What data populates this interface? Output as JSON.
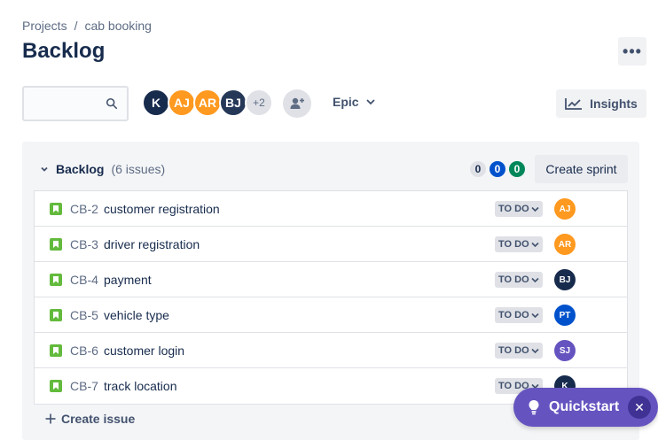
{
  "breadcrumb": {
    "root": "Projects",
    "separator": "/",
    "project": "cab booking"
  },
  "page": {
    "title": "Backlog",
    "more_label": "•••"
  },
  "search": {
    "placeholder": "",
    "value": ""
  },
  "avatars": [
    {
      "initials": "K",
      "color": "#172b4d"
    },
    {
      "initials": "AJ",
      "color": "#ff991f"
    },
    {
      "initials": "AR",
      "color": "#ff991f"
    },
    {
      "initials": "BJ",
      "color": "#253858"
    }
  ],
  "avatars_more": "+2",
  "filters": {
    "epic_label": "Epic"
  },
  "toolbar": {
    "insights_label": "Insights"
  },
  "backlog": {
    "title": "Backlog",
    "count": "(6 issues)",
    "counts": {
      "todo": "0",
      "in_progress": "0",
      "done": "0"
    },
    "create_sprint_label": "Create sprint",
    "create_issue_label": "Create issue"
  },
  "issues": [
    {
      "key": "CB-2",
      "summary": "customer registration",
      "status": "TO DO",
      "assignee": "AJ",
      "assignee_color": "#ff991f"
    },
    {
      "key": "CB-3",
      "summary": "driver registration",
      "status": "TO DO",
      "assignee": "AR",
      "assignee_color": "#ff991f"
    },
    {
      "key": "CB-4",
      "summary": "payment",
      "status": "TO DO",
      "assignee": "BJ",
      "assignee_color": "#172b4d"
    },
    {
      "key": "CB-5",
      "summary": "vehicle type",
      "status": "TO DO",
      "assignee": "PT",
      "assignee_color": "#0052cc"
    },
    {
      "key": "CB-6",
      "summary": "customer login",
      "status": "TO DO",
      "assignee": "SJ",
      "assignee_color": "#6554c0"
    },
    {
      "key": "CB-7",
      "summary": "track location",
      "status": "TO DO",
      "assignee": "K",
      "assignee_color": "#172b4d"
    }
  ],
  "quickstart": {
    "label": "Quickstart"
  }
}
